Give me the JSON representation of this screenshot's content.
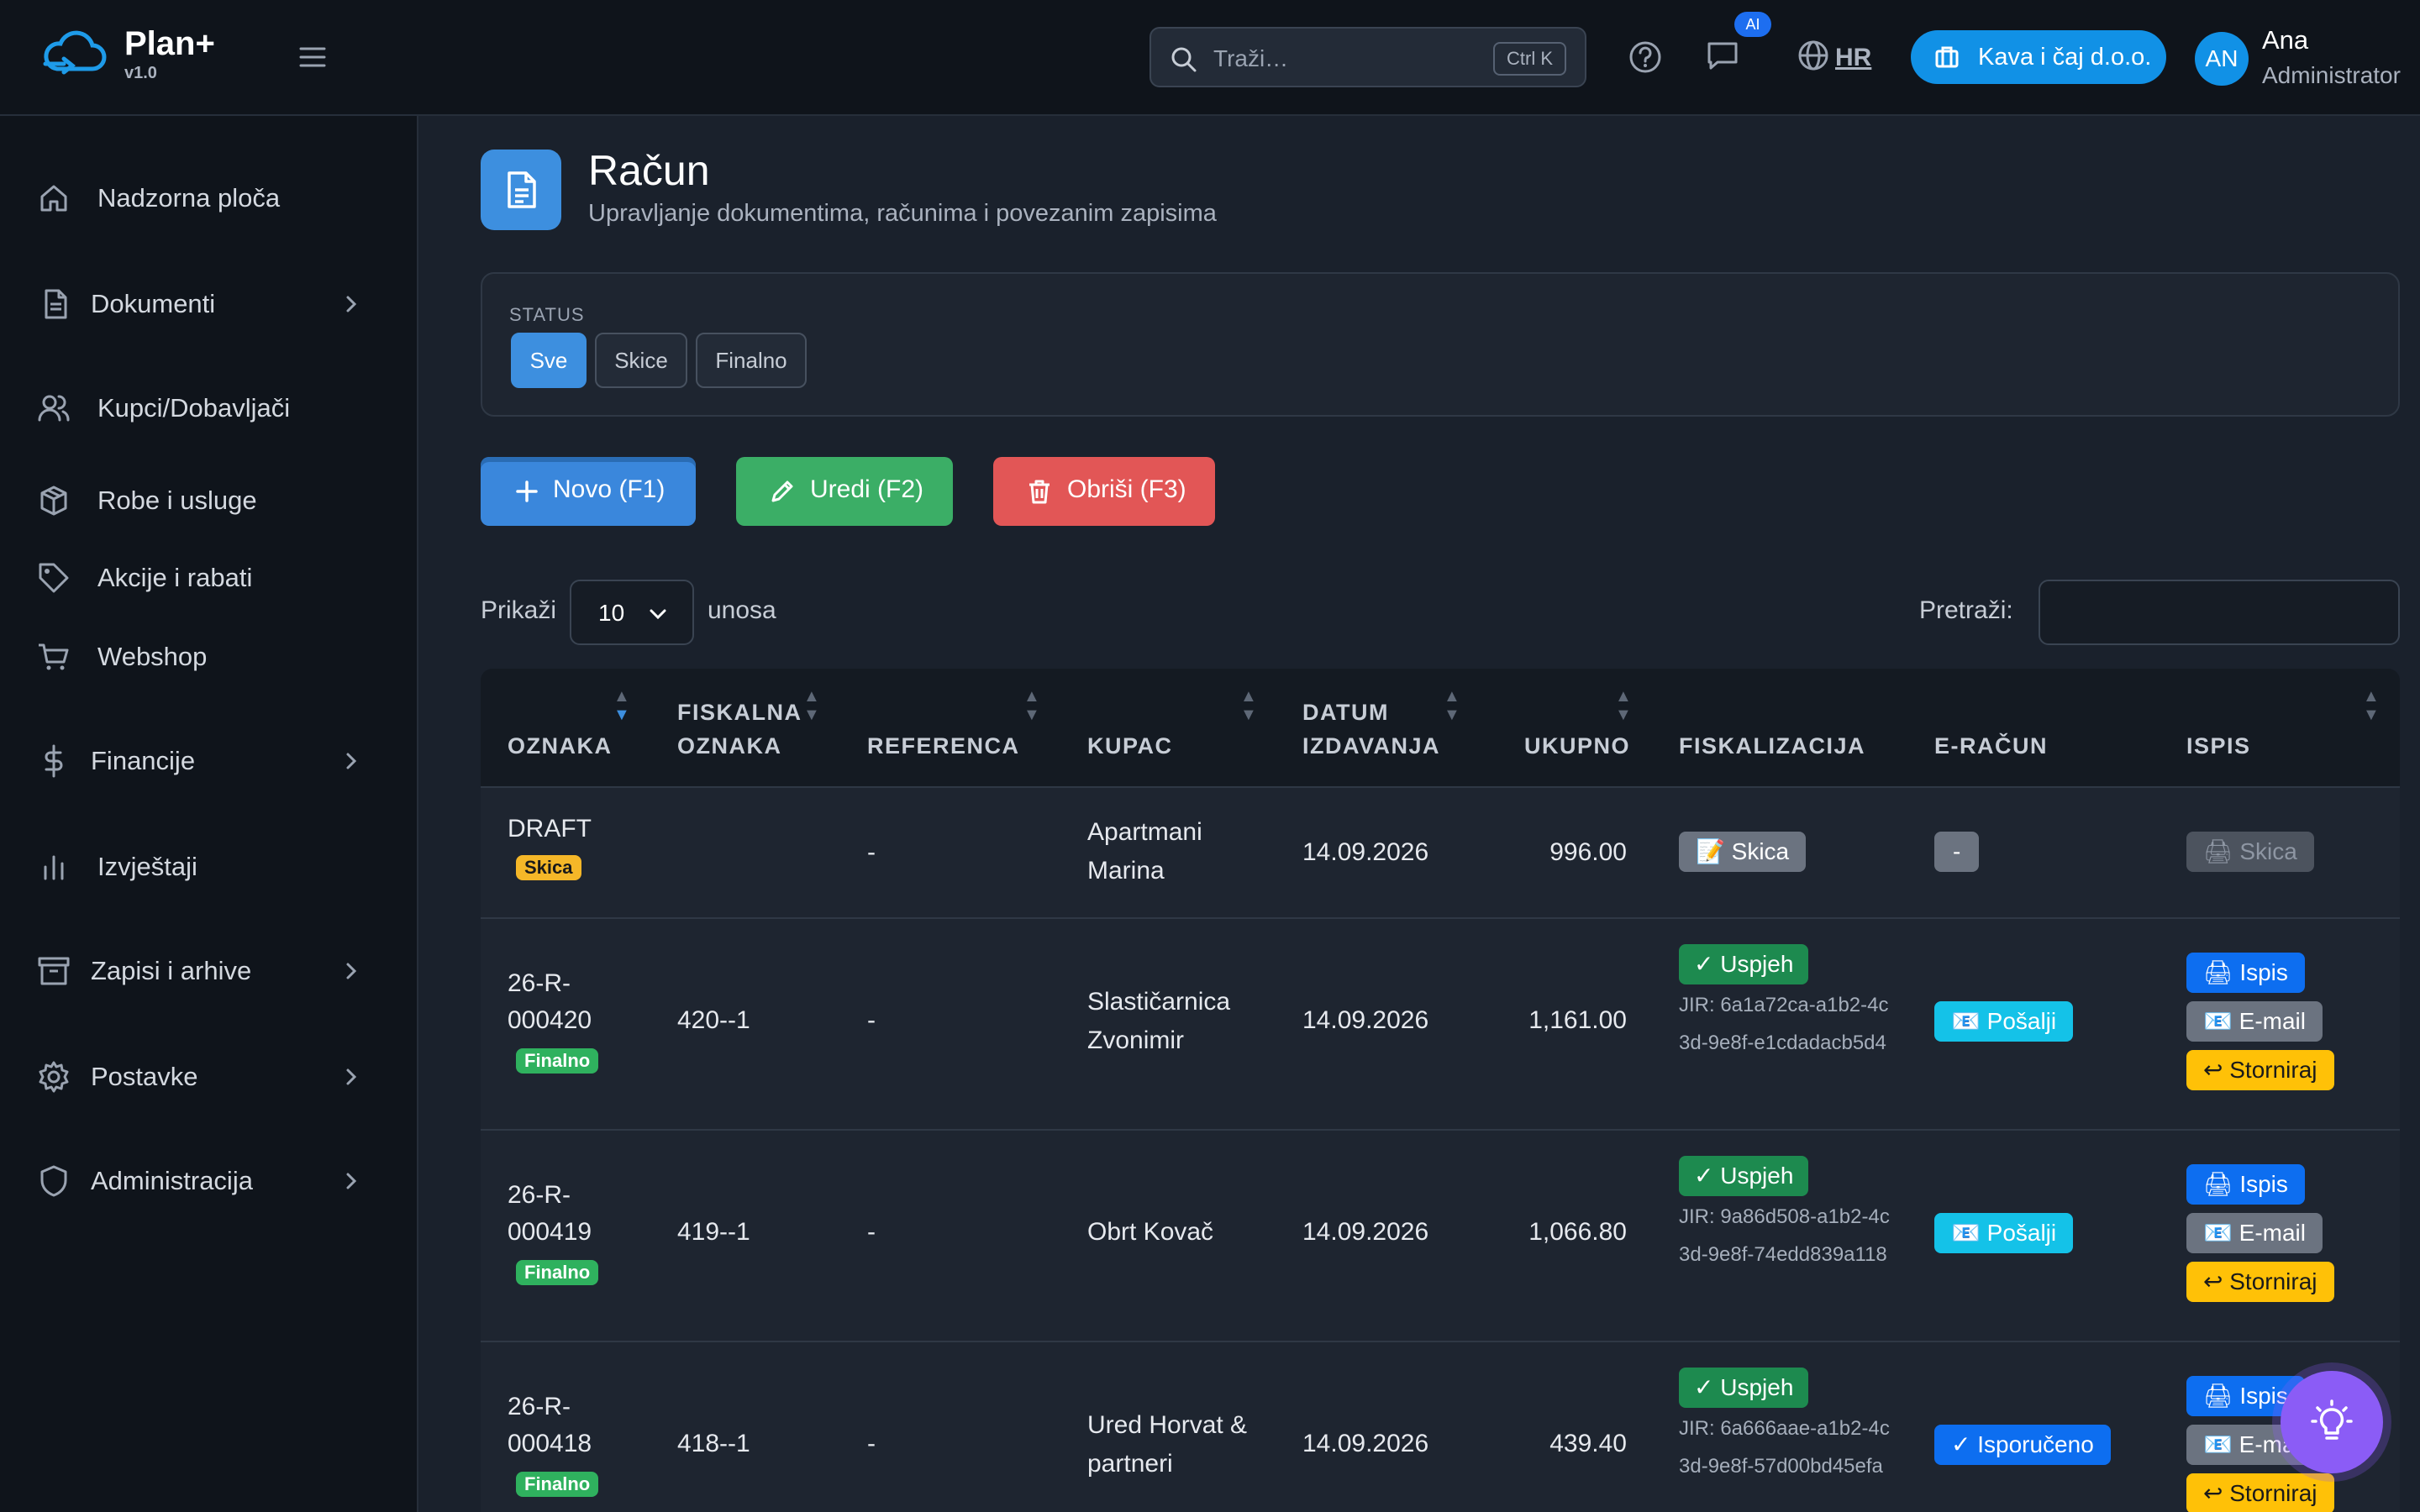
{
  "app": {
    "name": "Plan+",
    "version": "v1.0"
  },
  "topbar": {
    "search_placeholder": "Traži…",
    "search_shortcut": "Ctrl K",
    "ai_badge": "AI",
    "language": "HR",
    "company": "Kava i čaj d.o.o.",
    "user_initials": "AN",
    "user_name": "Ana",
    "user_role": "Administrator"
  },
  "sidebar": {
    "items": [
      {
        "label": "Nadzorna ploča",
        "icon": "home-icon",
        "expandable": false
      },
      {
        "label": "Dokumenti",
        "icon": "document-icon",
        "expandable": true
      },
      {
        "label": "Kupci/Dobavljači",
        "icon": "users-icon",
        "expandable": false
      },
      {
        "label": "Robe i usluge",
        "icon": "package-icon",
        "expandable": false
      },
      {
        "label": "Akcije i rabati",
        "icon": "tag-icon",
        "expandable": false
      },
      {
        "label": "Webshop",
        "icon": "cart-icon",
        "expandable": false
      },
      {
        "label": "Financije",
        "icon": "dollar-icon",
        "expandable": true
      },
      {
        "label": "Izvještaji",
        "icon": "bar-chart-icon",
        "expandable": false
      },
      {
        "label": "Zapisi i arhive",
        "icon": "archive-icon",
        "expandable": true
      },
      {
        "label": "Postavke",
        "icon": "gear-icon",
        "expandable": true
      },
      {
        "label": "Administracija",
        "icon": "shield-icon",
        "expandable": true
      }
    ]
  },
  "page": {
    "title": "Račun",
    "subtitle": "Upravljanje dokumentima, računima i povezanim zapisima"
  },
  "filter": {
    "label": "STATUS",
    "options": [
      "Sve",
      "Skice",
      "Finalno"
    ],
    "selected": "Sve"
  },
  "actions": {
    "new_label": "Novo (F1)",
    "edit_label": "Uredi (F2)",
    "delete_label": "Obriši (F3)"
  },
  "list_controls": {
    "show_label": "Prikaži",
    "page_size": "10",
    "entries_label": "unosa",
    "search_label": "Pretraži:",
    "search_value": ""
  },
  "table": {
    "headers": {
      "oznaka": "OZNAKA",
      "fiskalna_1": "FISKALNA",
      "fiskalna_2": "OZNAKA",
      "referenca": "REFERENCA",
      "kupac": "KUPAC",
      "datum_1": "DATUM",
      "datum_2": "IZDAVANJA",
      "ukupno": "UKUPNO",
      "fiskalizacija": "FISKALIZACIJA",
      "eracun": "E-RAČUN",
      "ispis": "ISPIS"
    },
    "rows": [
      {
        "oznaka": "DRAFT",
        "status": "Skica",
        "fiskalna": "",
        "referenca": "-",
        "kupac_1": "Apartmani",
        "kupac_2": "Marina",
        "datum": "14.09.2026",
        "ukupno": "996.00",
        "fisk_status": "📝 Skica",
        "eracun": "-",
        "ispis": "🖨 Skica"
      },
      {
        "oznaka_1": "26-R-",
        "oznaka_2": "000420",
        "status": "Finalno",
        "fiskalna": "420--1",
        "referenca": "-",
        "kupac_1": "Slastičarnica",
        "kupac_2": "Zvonimir",
        "datum": "14.09.2026",
        "ukupno": "1,161.00",
        "fisk_status": "✓ Uspjeh",
        "jir": "JIR: 6a1a72ca-a1b2-4c3d-9e8f-e1cdadacb5d4",
        "eracun": "📧 Pošalji",
        "ispis": "🖨 Ispis",
        "email": "📧 E-mail",
        "storno": "↩ Storniraj"
      },
      {
        "oznaka_1": "26-R-",
        "oznaka_2": "000419",
        "status": "Finalno",
        "fiskalna": "419--1",
        "referenca": "-",
        "kupac_1": "Obrt Kovač",
        "kupac_2": "",
        "datum": "14.09.2026",
        "ukupno": "1,066.80",
        "fisk_status": "✓ Uspjeh",
        "jir": "JIR: 9a86d508-a1b2-4c3d-9e8f-74edd839a118",
        "eracun": "📧 Pošalji",
        "ispis": "🖨 Ispis",
        "email": "📧 E-mail",
        "storno": "↩ Storniraj"
      },
      {
        "oznaka_1": "26-R-",
        "oznaka_2": "000418",
        "status": "Finalno",
        "fiskalna": "418--1",
        "referenca": "-",
        "kupac_1": "Ured Horvat &",
        "kupac_2": "partneri",
        "datum": "14.09.2026",
        "ukupno": "439.40",
        "fisk_status": "✓ Uspjeh",
        "jir": "JIR: 6a666aae-a1b2-4c3d-9e8f-57d00bd45efa",
        "eracun": "✓ Isporučeno",
        "ispis": "🖨 Ispis",
        "email": "📧 E-mail",
        "storno": "↩ Storniraj"
      }
    ]
  },
  "colors": {
    "accent": "#3d8fdf",
    "success": "#3bae66",
    "danger": "#e25656",
    "fab": "#8b5cf6"
  }
}
